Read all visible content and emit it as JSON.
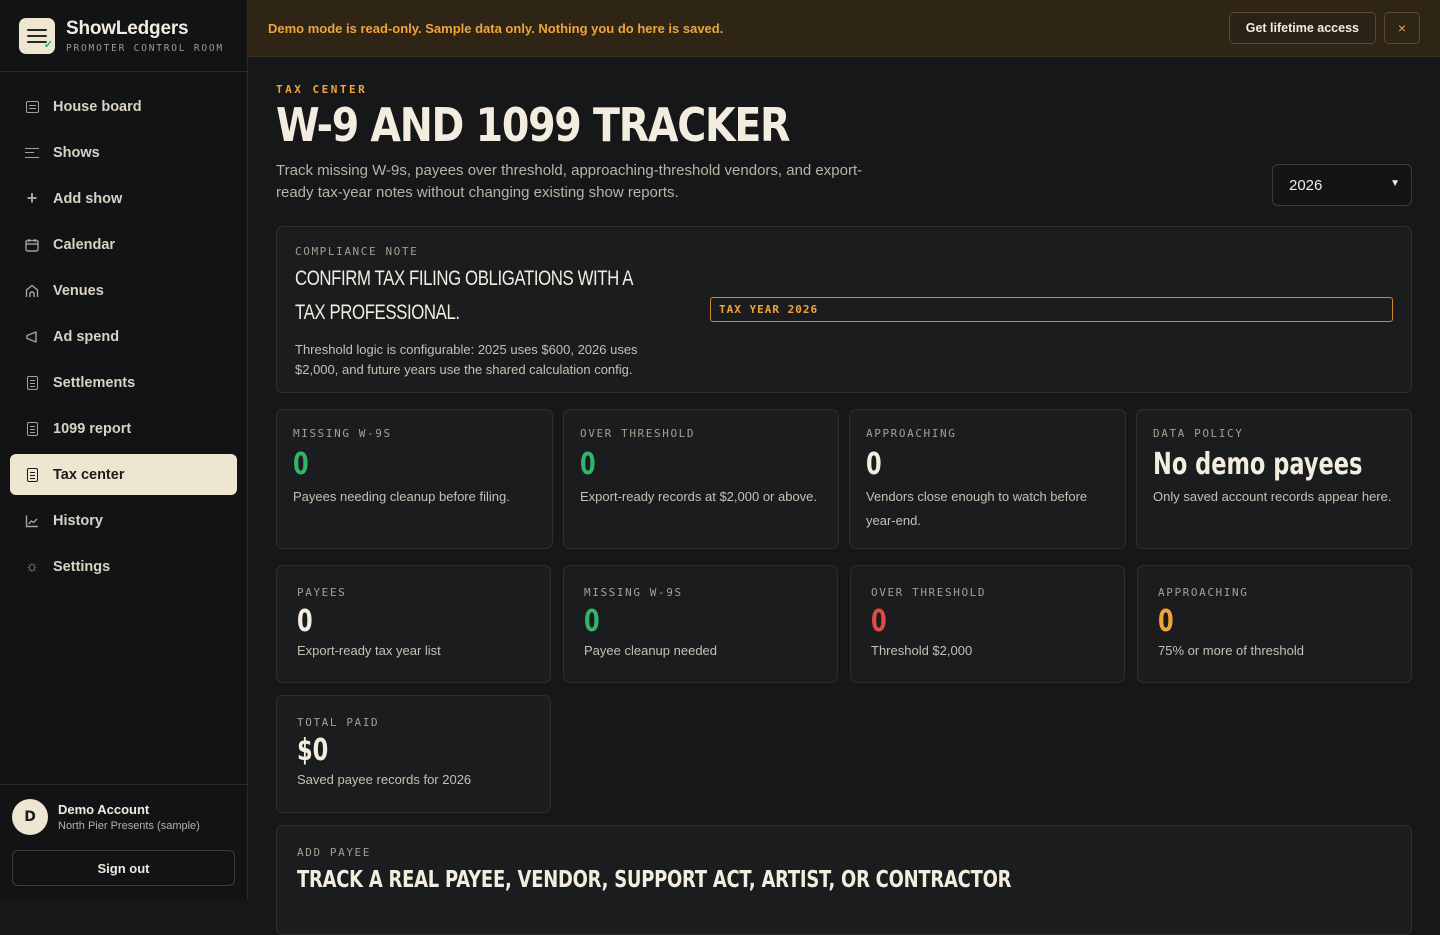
{
  "brand": {
    "name": "ShowLedgers",
    "subtitle": "PROMOTER CONTROL ROOM"
  },
  "nav": [
    {
      "label": "House board",
      "icon": "house-board-icon",
      "active": false
    },
    {
      "label": "Shows",
      "icon": "list-icon",
      "active": false
    },
    {
      "label": "Add show",
      "icon": "plus-icon",
      "active": false
    },
    {
      "label": "Calendar",
      "icon": "calendar-icon",
      "active": false
    },
    {
      "label": "Venues",
      "icon": "venue-icon",
      "active": false
    },
    {
      "label": "Ad spend",
      "icon": "megaphone-icon",
      "active": false
    },
    {
      "label": "Settlements",
      "icon": "document-icon",
      "active": false
    },
    {
      "label": "1099 report",
      "icon": "document-icon",
      "active": false
    },
    {
      "label": "Tax center",
      "icon": "document-icon",
      "active": true
    },
    {
      "label": "History",
      "icon": "chart-icon",
      "active": false
    },
    {
      "label": "Settings",
      "icon": "gear-icon",
      "active": false
    }
  ],
  "account": {
    "initial": "D",
    "name": "Demo Account",
    "org": "North Pier Presents (sample)",
    "signout": "Sign out"
  },
  "banner": {
    "text": "Demo mode is read-only. Sample data only. Nothing you do here is saved.",
    "cta": "Get lifetime access",
    "close": "×"
  },
  "header": {
    "eyebrow": "TAX CENTER",
    "title": "W-9 AND 1099 TRACKER",
    "description": "Track missing W-9s, payees over threshold, approaching-threshold vendors, and export-ready tax-year notes without changing existing show reports.",
    "year": "2026"
  },
  "compliance": {
    "label": "COMPLIANCE NOTE",
    "title": "CONFIRM TAX FILING OBLIGATIONS WITH A TAX PROFESSIONAL.",
    "description": "Threshold logic is configurable: 2025 uses $600, 2026 uses $2,000, and future years use the shared calculation config.",
    "pill": "TAX YEAR 2026"
  },
  "summary": [
    {
      "label": "MISSING W-9S",
      "value": "0",
      "desc": "Payees needing cleanup before filing.",
      "tone": "green"
    },
    {
      "label": "OVER THRESHOLD",
      "value": "0",
      "desc": "Export-ready records at $2,000 or above.",
      "tone": "green"
    },
    {
      "label": "APPROACHING",
      "value": "0",
      "desc": "Vendors close enough to watch before year-end.",
      "tone": "white"
    },
    {
      "label": "DATA POLICY",
      "value": "No demo payees",
      "desc": "Only saved account records appear here.",
      "tone": "white"
    }
  ],
  "stats": [
    {
      "label": "PAYEES",
      "value": "0",
      "desc": "Export-ready tax year list",
      "tone": "white"
    },
    {
      "label": "MISSING W-9S",
      "value": "0",
      "desc": "Payee cleanup needed",
      "tone": "green"
    },
    {
      "label": "OVER THRESHOLD",
      "value": "0",
      "desc": "Threshold $2,000",
      "tone": "red"
    },
    {
      "label": "APPROACHING",
      "value": "0",
      "desc": "75% or more of threshold",
      "tone": "orange"
    }
  ],
  "total": {
    "label": "TOTAL PAID",
    "value": "$0",
    "desc": "Saved payee records for 2026"
  },
  "add_payee": {
    "label": "ADD PAYEE",
    "title": "TRACK A REAL PAYEE, VENDOR, SUPPORT ACT, ARTIST, OR CONTRACTOR"
  },
  "colors": {
    "accent": "#f0a43a",
    "green": "#33b46b",
    "red": "#e04a43",
    "cream": "#efe6d2",
    "bg": "#161718"
  }
}
